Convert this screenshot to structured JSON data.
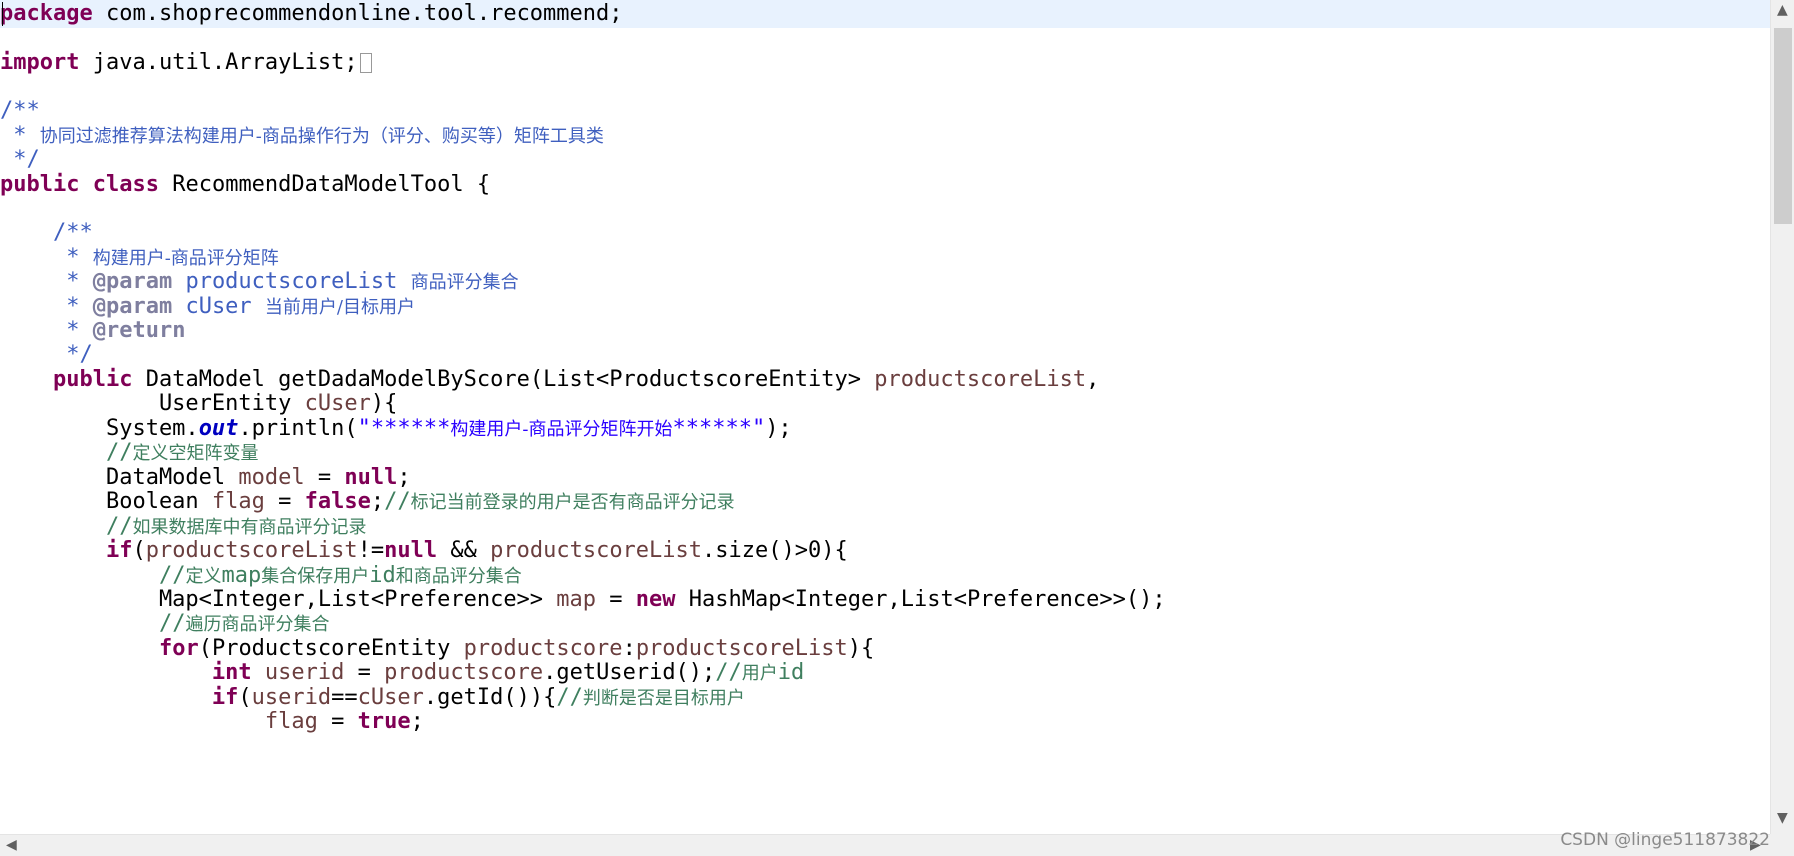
{
  "code": {
    "l1": {
      "kw": "package",
      "rest": " com.shoprecommendonline.tool.recommend;"
    },
    "l3": {
      "kw": "import",
      "rest": " java.util.ArrayList;"
    },
    "l5": "/**",
    "l6": {
      "star": " * ",
      "text": "协同过滤推荐算法构建用户-商品操作行为（评分、购买等）矩阵工具类"
    },
    "l7": " */",
    "l8": {
      "kw1": "public",
      "kw2": "class",
      "rest": " RecommendDataModelTool {"
    },
    "l10": "    /**",
    "l11": {
      "star": "     * ",
      "text": "构建用户-商品评分矩阵"
    },
    "l12": {
      "star": "     * ",
      "tag": "@param",
      "name": " productscoreList ",
      "text": "商品评分集合"
    },
    "l13": {
      "star": "     * ",
      "tag": "@param",
      "name": " cUser ",
      "text": "当前用户/目标用户"
    },
    "l14": {
      "star": "     * ",
      "tag": "@return"
    },
    "l15": "     */",
    "l16": {
      "indent": "    ",
      "kw": "public",
      "t1": " DataModel getDadaModelByScore(List<ProductscoreEntity> ",
      "v": "productscoreList",
      "t2": ","
    },
    "l17": {
      "indent": "            UserEntity ",
      "v": "cUser",
      "t": "){"
    },
    "l18": {
      "indent": "        System.",
      "fld": "out",
      "t1": ".println(",
      "s1": "\"******",
      "s2": "构建用户-商品评分矩阵开始",
      "s3": "******\"",
      "t2": ");"
    },
    "l19": {
      "indent": "        ",
      "slashes": "//",
      "text": "定义空矩阵变量"
    },
    "l20": {
      "indent": "        DataModel ",
      "v": "model",
      "t": " = ",
      "kw": "null",
      "end": ";"
    },
    "l21": {
      "indent": "        Boolean ",
      "v": "flag",
      "t": " = ",
      "kw": "false",
      "end": ";",
      "slashes": "//",
      "text": "标记当前登录的用户是否有商品评分记录"
    },
    "l22": {
      "indent": "        ",
      "slashes": "//",
      "text": "如果数据库中有商品评分记录"
    },
    "l23": {
      "indent": "        ",
      "kw": "if",
      "t1": "(",
      "v1": "productscoreList",
      "t2": "!=",
      "kw2": "null",
      "t3": " && ",
      "v2": "productscoreList",
      "t4": ".size()>0){"
    },
    "l24": {
      "indent": "            ",
      "slashes": "//",
      "text1": "定义",
      "m1": "map",
      "text2": "集合保存用户",
      "m2": "id",
      "text3": "和商品评分集合"
    },
    "l25": {
      "indent": "            Map<Integer,List<Preference>> ",
      "v": "map",
      "t1": " = ",
      "kw": "new",
      "t2": " HashMap<Integer,List<Preference>>();"
    },
    "l26": {
      "indent": "            ",
      "slashes": "//",
      "text": "遍历商品评分集合"
    },
    "l27": {
      "indent": "            ",
      "kw": "for",
      "t1": "(ProductscoreEntity ",
      "v1": "productscore",
      "t2": ":",
      "v2": "productscoreList",
      "t3": "){"
    },
    "l28": {
      "indent": "                ",
      "kw": "int",
      "t1": " ",
      "v1": "userid",
      "t2": " = ",
      "v2": "productscore",
      "t3": ".getUserid();",
      "slashes": "//",
      "text": "用户",
      "m": "id"
    },
    "l29": {
      "indent": "                ",
      "kw": "if",
      "t1": "(",
      "v1": "userid",
      "t2": "==",
      "v2": "cUser",
      "t3": ".getId()){",
      "slashes": "//",
      "text": "判断是否是目标用户"
    },
    "l30": {
      "indent": "                    ",
      "v": "flag",
      "t": " = ",
      "kw": "true",
      "end": ";"
    }
  },
  "watermark": "CSDN @linge511873822",
  "icons": {
    "scroll_up": "chevron-up-icon",
    "scroll_down": "chevron-down-icon",
    "scroll_left": "chevron-left-icon",
    "scroll_right": "chevron-right-icon"
  },
  "colors": {
    "keyword": "#7f0055",
    "string": "#2a00ff",
    "comment": "#3f7f5f",
    "javadoc": "#3f5fbf",
    "javadoc_tag": "#7f7f9f",
    "variable": "#6a3e3e",
    "current_line": "#e8f2fe"
  }
}
